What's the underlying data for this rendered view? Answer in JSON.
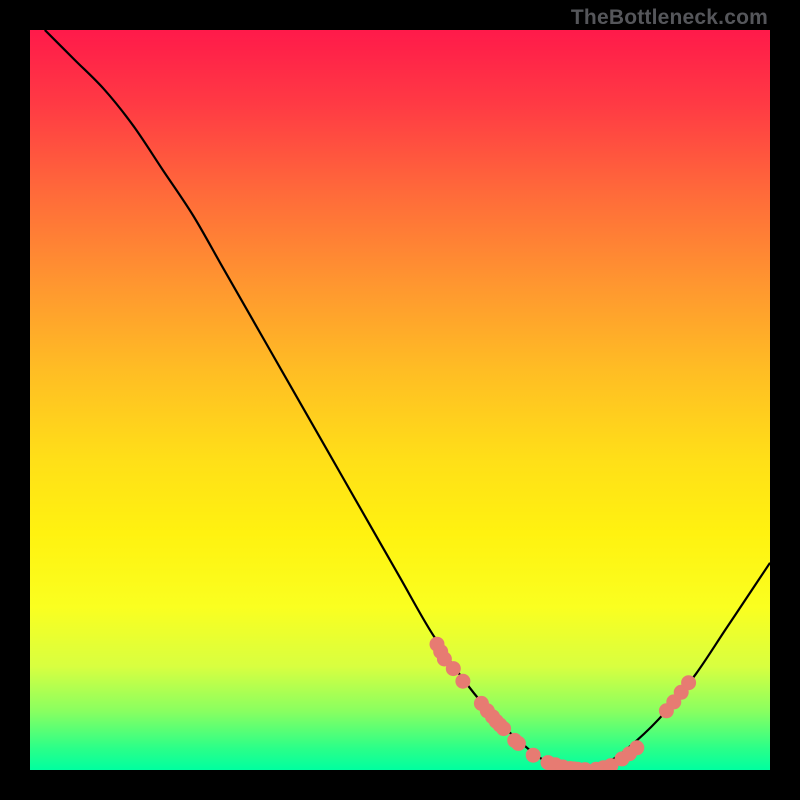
{
  "watermark": "TheBottleneck.com",
  "colors": {
    "marker": "#e77b72",
    "curve": "#000000"
  },
  "chart_data": {
    "type": "line",
    "title": "",
    "xlabel": "",
    "ylabel": "",
    "xlim": [
      0,
      100
    ],
    "ylim": [
      0,
      100
    ],
    "grid": false,
    "legend": false,
    "series": [
      {
        "name": "curve",
        "x": [
          2,
          6,
          10,
          14,
          18,
          22,
          26,
          30,
          34,
          38,
          42,
          46,
          50,
          54,
          58,
          62,
          66,
          70,
          74,
          78,
          82,
          86,
          90,
          94,
          98,
          100
        ],
        "y": [
          100,
          96,
          92,
          87,
          81,
          75,
          68,
          61,
          54,
          47,
          40,
          33,
          26,
          19,
          13,
          8,
          4,
          1,
          0,
          1,
          4,
          8,
          13,
          19,
          25,
          28
        ]
      }
    ],
    "markers": [
      {
        "x": 55.0,
        "y": 17
      },
      {
        "x": 55.5,
        "y": 16
      },
      {
        "x": 56.0,
        "y": 15
      },
      {
        "x": 57.2,
        "y": 13.7
      },
      {
        "x": 58.5,
        "y": 12
      },
      {
        "x": 61.0,
        "y": 9
      },
      {
        "x": 61.8,
        "y": 8
      },
      {
        "x": 62.5,
        "y": 7.2
      },
      {
        "x": 63.0,
        "y": 6.6
      },
      {
        "x": 63.5,
        "y": 6.1
      },
      {
        "x": 64.0,
        "y": 5.6
      },
      {
        "x": 65.5,
        "y": 4.0
      },
      {
        "x": 66.0,
        "y": 3.6
      },
      {
        "x": 68.0,
        "y": 2.0
      },
      {
        "x": 70.0,
        "y": 1.0
      },
      {
        "x": 71.0,
        "y": 0.7
      },
      {
        "x": 72.0,
        "y": 0.4
      },
      {
        "x": 73.0,
        "y": 0.2
      },
      {
        "x": 73.5,
        "y": 0.15
      },
      {
        "x": 74.0,
        "y": 0.1
      },
      {
        "x": 75.0,
        "y": 0.05
      },
      {
        "x": 76.5,
        "y": 0.1
      },
      {
        "x": 77.5,
        "y": 0.3
      },
      {
        "x": 78.5,
        "y": 0.6
      },
      {
        "x": 80.0,
        "y": 1.5
      },
      {
        "x": 81.0,
        "y": 2.2
      },
      {
        "x": 82.0,
        "y": 3.0
      },
      {
        "x": 86.0,
        "y": 8.0
      },
      {
        "x": 87.0,
        "y": 9.2
      },
      {
        "x": 88.0,
        "y": 10.5
      },
      {
        "x": 89.0,
        "y": 11.8
      }
    ]
  }
}
